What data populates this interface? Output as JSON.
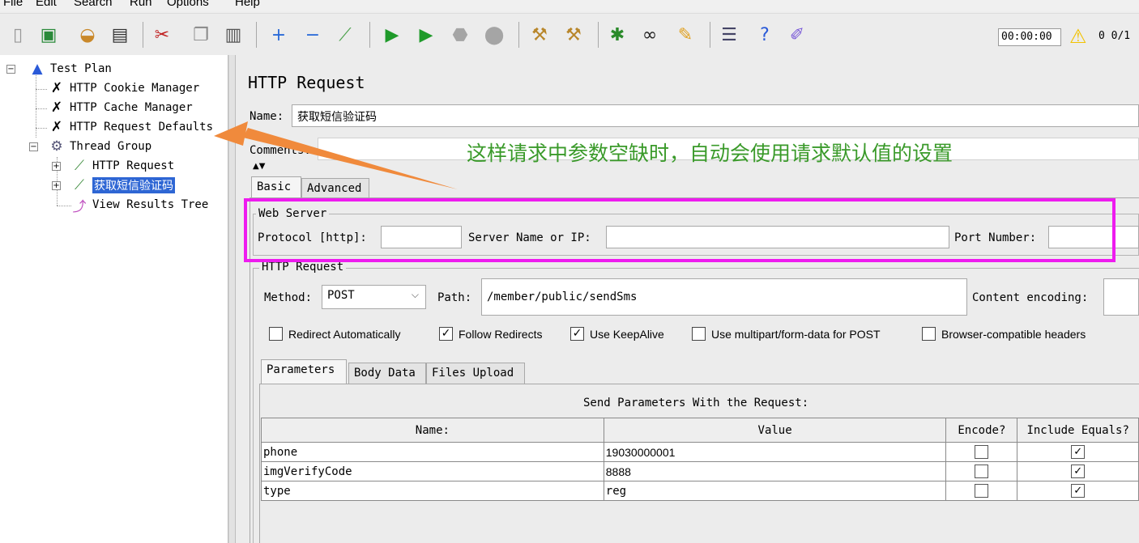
{
  "menu": [
    "File",
    "Edit",
    "Search",
    "Run",
    "Options",
    "Help"
  ],
  "toolbar": {
    "icons": [
      "new-icon",
      "templates-icon",
      "open-icon",
      "save-icon",
      "cut-icon",
      "copy-icon",
      "paste-icon",
      "expand-icon",
      "collapse-icon",
      "toggle-icon",
      "start-icon",
      "start-no-pause-icon",
      "stop-icon",
      "shutdown-icon",
      "clear-icon",
      "clear-all-icon",
      "search-icon",
      "find-icon",
      "reset-search-icon",
      "function-helper-icon",
      "help-icon",
      "remote-icon"
    ],
    "timer": "00:00:00",
    "warning_count": "0",
    "threads": "0/1"
  },
  "tree": {
    "test_plan": "Test Plan",
    "cookie_manager": "HTTP Cookie Manager",
    "cache_manager": "HTTP Cache Manager",
    "request_defaults": "HTTP Request Defaults",
    "thread_group": "Thread Group",
    "http_request": "HTTP Request",
    "sms_request": "获取短信验证码",
    "results_tree": "View Results Tree"
  },
  "panel": {
    "title": "HTTP Request",
    "name_label": "Name:",
    "name_value": "获取短信验证码",
    "comments_label": "Comments:",
    "tabs": [
      "Basic",
      "Advanced"
    ],
    "web_server": {
      "legend": "Web Server",
      "protocol_label": "Protocol [http]:",
      "protocol_value": "",
      "server_label": "Server Name or IP:",
      "server_value": "",
      "port_label": "Port Number:",
      "port_value": ""
    },
    "http_request": {
      "legend": "HTTP Request",
      "method_label": "Method:",
      "method_value": "POST",
      "path_label": "Path:",
      "path_value": "/member/public/sendSms",
      "encoding_label": "Content encoding:",
      "encoding_value": ""
    },
    "checkboxes": [
      {
        "label": "Redirect Automatically",
        "checked": false
      },
      {
        "label": "Follow Redirects",
        "checked": true
      },
      {
        "label": "Use KeepAlive",
        "checked": true
      },
      {
        "label": "Use multipart/form-data for POST",
        "checked": false
      },
      {
        "label": "Browser-compatible headers",
        "checked": false
      }
    ],
    "sub_tabs": [
      "Parameters",
      "Body Data",
      "Files Upload"
    ],
    "params_caption": "Send Parameters With the Request:",
    "columns": [
      "Name:",
      "Value",
      "Encode?",
      "Include Equals?"
    ],
    "rows": [
      {
        "name": "phone",
        "value": "19030000001",
        "encode": false,
        "include_equals": true
      },
      {
        "name": "imgVerifyCode",
        "value": "8888",
        "encode": false,
        "include_equals": true
      },
      {
        "name": "type",
        "value": "reg",
        "encode": false,
        "include_equals": true
      }
    ]
  },
  "annotation": "这样请求中参数空缺时，自动会使用请求默认值的设置",
  "colors": {
    "highlight": "#ee1bef",
    "arrow": "#f08a3c",
    "annotation": "#3a9a2a",
    "selection": "#2e66d4"
  }
}
